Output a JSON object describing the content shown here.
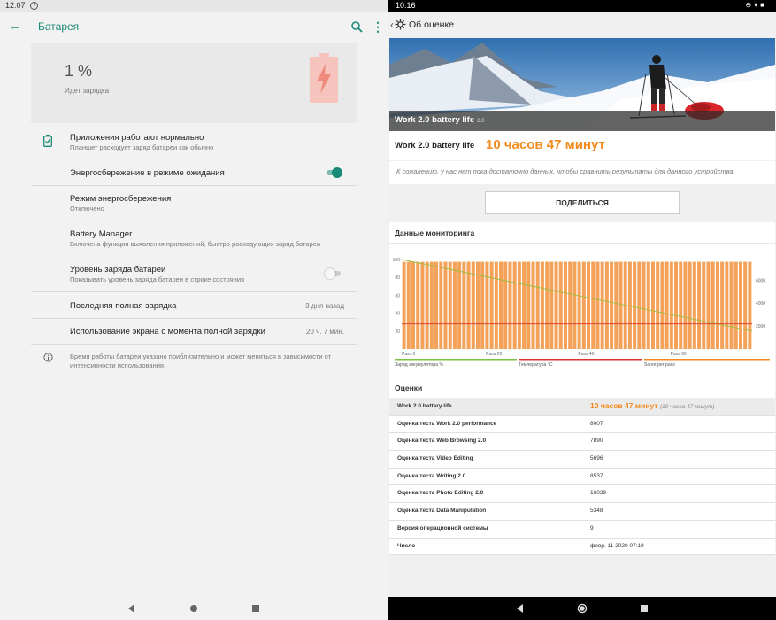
{
  "left": {
    "status": {
      "time": "12:07",
      "notification": "!"
    },
    "appbar": {
      "title": "Батарея"
    },
    "battery_card": {
      "percent": "1 %",
      "status": "Идет зарядка",
      "level": 0.01
    },
    "rows": [
      {
        "title": "Приложения работают нормально",
        "subtitle": "Планшет расходует заряд батареи как обычно"
      },
      {
        "title": "Энергосбережение в режиме ожидания",
        "toggle": true
      },
      {
        "title": "Режим энергосбережения",
        "subtitle": "Отключено"
      },
      {
        "title": "Battery Manager",
        "subtitle": "Включена функция выявления приложений, быстро расходующих заряд батареи"
      },
      {
        "title": "Уровень заряда батареи",
        "subtitle": "Показывать уровень заряда батареи в строке состояния",
        "toggle": false
      },
      {
        "title": "Последняя полная зарядка",
        "value": "3 дня назад"
      },
      {
        "title": "Использование экрана с момента полной зарядки",
        "value": "20 ч. 7 мин."
      }
    ],
    "footer_note": "Время работы батареи указано приблизительно и может меняться в зависимости от интенсивности использования.",
    "accent_color": "#1a8a78"
  },
  "right": {
    "status": {
      "time": "10:16"
    },
    "appbar": {
      "title": "Об оценке"
    },
    "hero": {
      "label": "Work 2.0 battery life",
      "version": "2.0"
    },
    "result": {
      "name": "Work 2.0 battery life",
      "value": "10 часов 47 минут"
    },
    "note": "К сожалению, у нас нет пока достаточно данных, чтобы сравнить результаты для данного устройства.",
    "share_label": "ПОДЕЛИТЬСЯ",
    "monitoring": {
      "title": "Данные мониторинга",
      "legend": [
        {
          "label": "Заряд аккумулятора %",
          "color": "#7cc242"
        },
        {
          "label": "Температура °C",
          "color": "#d9342b"
        },
        {
          "label": "Score per pass",
          "color": "#f28b1e"
        }
      ]
    },
    "scores_title": "Оценки",
    "scores": [
      {
        "label": "Work 2.0 battery life",
        "value": "10 часов 47 минут",
        "sub": "(10 часов 47 минут)",
        "highlight": true
      },
      {
        "label": "Оценка теста Work 2.0 performance",
        "value": "8007"
      },
      {
        "label": "Оценка теста Web Browsing 2.0",
        "value": "7890"
      },
      {
        "label": "Оценка теста Video Editing",
        "value": "5696"
      },
      {
        "label": "Оценка теста Writing 2.0",
        "value": "8537"
      },
      {
        "label": "Оценка теста Photo Editing 2.0",
        "value": "16039"
      },
      {
        "label": "Оценка теста Data Manipulation",
        "value": "5348"
      },
      {
        "label": "Версия операционной системы",
        "value": "9"
      },
      {
        "label": "Число",
        "value": "февр. 11 2020 07:19"
      }
    ],
    "accent_color": "#f28b1e"
  },
  "chart_data": {
    "type": "bar",
    "title": "Данные мониторинга",
    "xlabel": "",
    "ylabel": "",
    "x_ticks": [
      "Pass 0",
      "Pass 20",
      "Pass 40",
      "Pass 60"
    ],
    "y_ticks_left": [
      20,
      40,
      60,
      80,
      100
    ],
    "y_ticks_right": [
      2000,
      4000,
      6000
    ],
    "ylim_left": [
      0,
      100
    ],
    "ylim_right": [
      0,
      7800
    ],
    "passes": 76,
    "series": [
      {
        "name": "Score per pass",
        "type": "bar",
        "axis": "right",
        "approx_value": 7600
      },
      {
        "name": "Заряд аккумулятора %",
        "type": "line",
        "axis": "left",
        "start": 100,
        "end": 20
      },
      {
        "name": "Температура °C",
        "type": "line",
        "axis": "left",
        "approx_value": 28
      }
    ]
  }
}
